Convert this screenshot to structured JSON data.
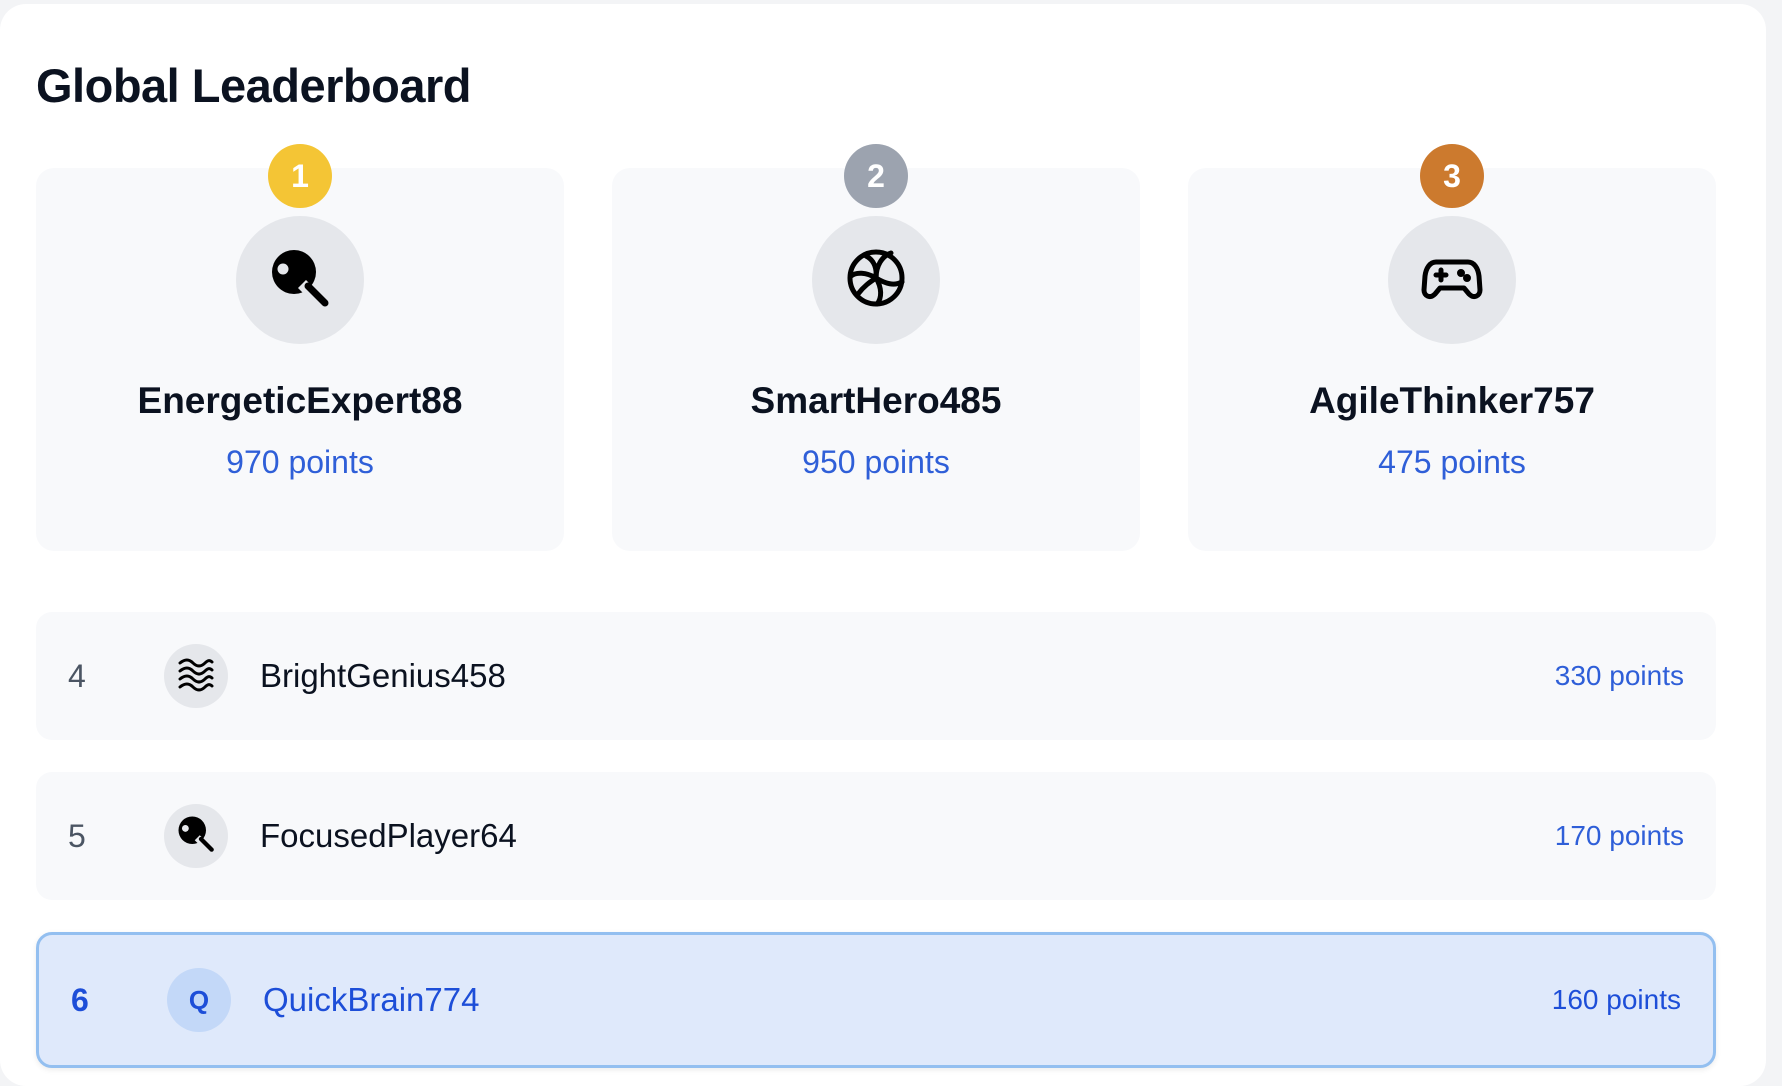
{
  "leaderboard": {
    "title": "Global Leaderboard",
    "podium": [
      {
        "rank": "1",
        "name": "EnergeticExpert88",
        "points": "970 points",
        "icon": "ping-pong-paddle-icon",
        "badge_color": "#f4c535"
      },
      {
        "rank": "2",
        "name": "SmartHero485",
        "points": "950 points",
        "icon": "volleyball-icon",
        "badge_color": "#9ca3af"
      },
      {
        "rank": "3",
        "name": "AgileThinker757",
        "points": "475 points",
        "icon": "gamepad-icon",
        "badge_color": "#cc7a2e"
      }
    ],
    "rows": [
      {
        "rank": "4",
        "name": "BrightGenius458",
        "points": "330 points",
        "icon": "waves-icon"
      },
      {
        "rank": "5",
        "name": "FocusedPlayer64",
        "points": "170 points",
        "icon": "ping-pong-paddle-icon"
      },
      {
        "rank": "6",
        "name": "QuickBrain774",
        "points": "160 points",
        "avatar_initial": "Q",
        "current_user": true
      }
    ]
  },
  "colors": {
    "accent": "#2f5fd8",
    "current_row_bg": "#dfe9fb",
    "current_row_border": "#93bff0"
  }
}
